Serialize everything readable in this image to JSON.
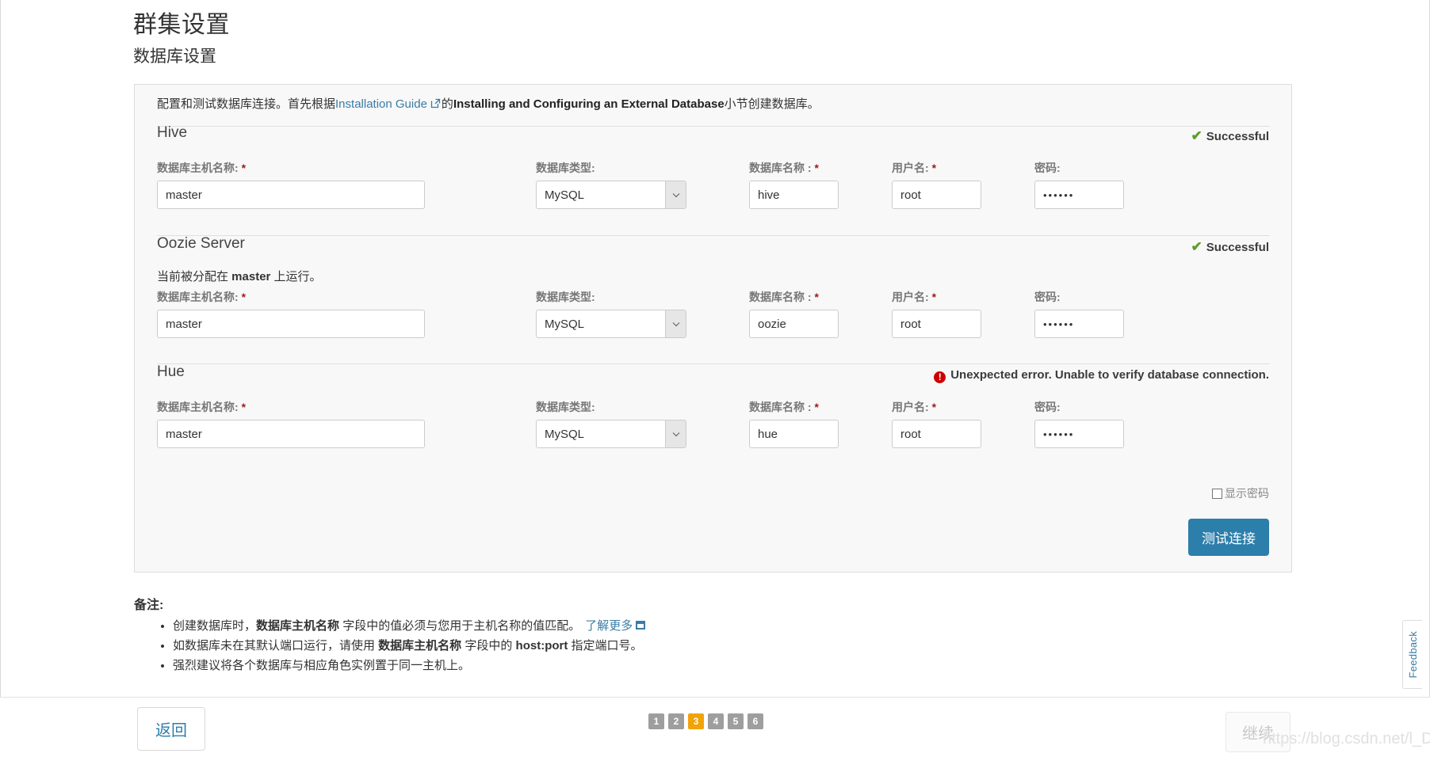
{
  "page": {
    "title": "群集设置",
    "section_title": "数据库设置"
  },
  "panel": {
    "desc_pre": "配置和测试数据库连接。首先根据",
    "desc_link": "Installation Guide",
    "desc_mid": "的",
    "desc_bold": "Installing and Configuring an External Database",
    "desc_post": "小节创建数据库。",
    "link_icon": "external-link-icon"
  },
  "labels": {
    "host": "数据库主机名称:",
    "type": "数据库类型:",
    "dbname": "数据库名称 :",
    "user": "用户名:",
    "password": "密码:",
    "required_mark": "*"
  },
  "groups": [
    {
      "name": "Hive",
      "status_text": "Successful",
      "status_kind": "ok",
      "status_icon": "check-icon",
      "assigned_note": null,
      "host": "master",
      "type": "MySQL",
      "dbname": "hive",
      "user": "root",
      "password": "••••••"
    },
    {
      "name": "Oozie Server",
      "status_text": "Successful",
      "status_kind": "ok",
      "status_icon": "check-icon",
      "assigned_note_pre": "当前被分配在 ",
      "assigned_note_host": "master",
      "assigned_note_post": " 上运行。",
      "host": "master",
      "type": "MySQL",
      "dbname": "oozie",
      "user": "root",
      "password": "••••••"
    },
    {
      "name": "Hue",
      "status_text": "Unexpected error. Unable to verify database connection.",
      "status_kind": "err",
      "status_icon": "error-icon",
      "assigned_note": null,
      "host": "master",
      "type": "MySQL",
      "dbname": "hue",
      "user": "root",
      "password": "••••••"
    }
  ],
  "controls": {
    "show_password_label": "显示密码",
    "test_connection_label": "测试连接"
  },
  "notes": {
    "title": "备注:",
    "items": [
      {
        "pre": "创建数据库时，",
        "bold": "数据库主机名称",
        "post": " 字段中的值必须与您用于主机名称的值匹配。",
        "link": "了解更多",
        "link_icon": "popout-icon"
      },
      {
        "pre": "如数据库未在其默认端口运行，请使用 ",
        "bold": "数据库主机名称",
        "mid": " 字段中的 ",
        "bold2": "host:port",
        "post": " 指定端口号。"
      },
      {
        "pre": "强烈建议将各个数据库与相应角色实例置于同一主机上。"
      }
    ]
  },
  "footer": {
    "back_label": "返回",
    "next_label": "继续",
    "pages": [
      "1",
      "2",
      "3",
      "4",
      "5",
      "6"
    ],
    "active_page": "3",
    "watermark": "https://blog.csdn.net/l_Demo",
    "feedback_label": "Feedback"
  },
  "colors": {
    "accent": "#2c7eab",
    "success": "#5aa02c",
    "error": "#cc0000",
    "active_page": "#f0a30a",
    "link": "#3a7ca5"
  }
}
